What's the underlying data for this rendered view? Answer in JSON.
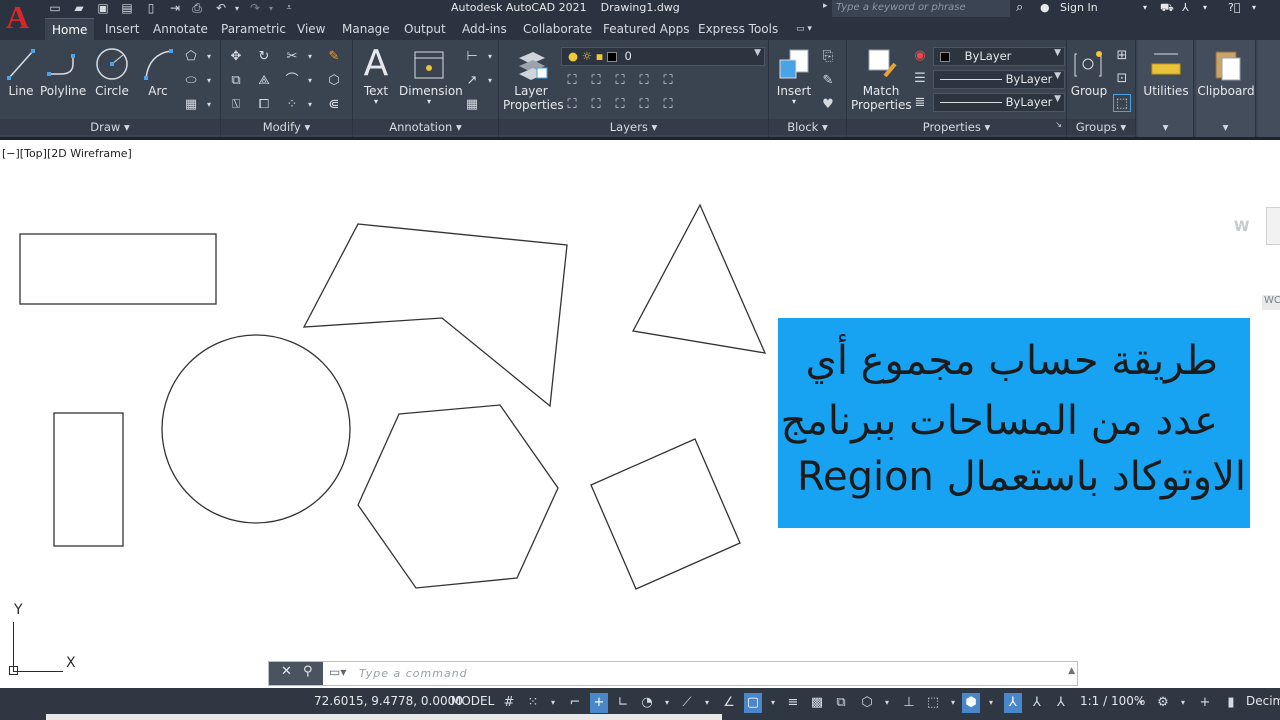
{
  "titlebar": {
    "app_name": "Autodesk AutoCAD 2021",
    "file_name": "Drawing1.dwg",
    "search_placeholder": "Type a keyword or phrase",
    "sign_in": "Sign In"
  },
  "tabs": [
    "Home",
    "Insert",
    "Annotate",
    "Parametric",
    "View",
    "Manage",
    "Output",
    "Add-ins",
    "Collaborate",
    "Featured Apps",
    "Express Tools"
  ],
  "ribbon": {
    "draw": {
      "title": "Draw",
      "tools": [
        "Line",
        "Polyline",
        "Circle",
        "Arc"
      ]
    },
    "modify": {
      "title": "Modify"
    },
    "annotation": {
      "title": "Annotation",
      "tools": [
        "Text",
        "Dimension"
      ]
    },
    "layers": {
      "title": "Layers",
      "layer_properties": [
        "Layer",
        "Properties"
      ],
      "current_layer": "0"
    },
    "block": {
      "title": "Block",
      "insert": "Insert"
    },
    "properties": {
      "title": "Properties",
      "match": [
        "Match",
        "Properties"
      ],
      "color": "ByLayer",
      "linetype": "ByLayer",
      "lineweight": "ByLayer"
    },
    "groups": {
      "title": "Groups",
      "group": "Group"
    },
    "utilities": "Utilities",
    "clipboard": "Clipboard"
  },
  "viewport_label": "[−][Top][2D Wireframe]",
  "overlay": {
    "line1": "طريقة حساب مجموع  أي",
    "line2": "عدد من المساحات ببرنامج",
    "line3": "الاوتوكاد باستعمال Region",
    "bg_color": "#17a3f2"
  },
  "viewcube": {
    "w_label": "W",
    "wcs_label": "WC"
  },
  "ucs": {
    "y": "Y",
    "x": "X"
  },
  "command": {
    "placeholder": "Type  a  command"
  },
  "statusbar": {
    "coords": "72.6015, 9.4778, 0.0000",
    "space": "MODEL",
    "scale": "1:1 / 100%",
    "units": "Decim"
  }
}
